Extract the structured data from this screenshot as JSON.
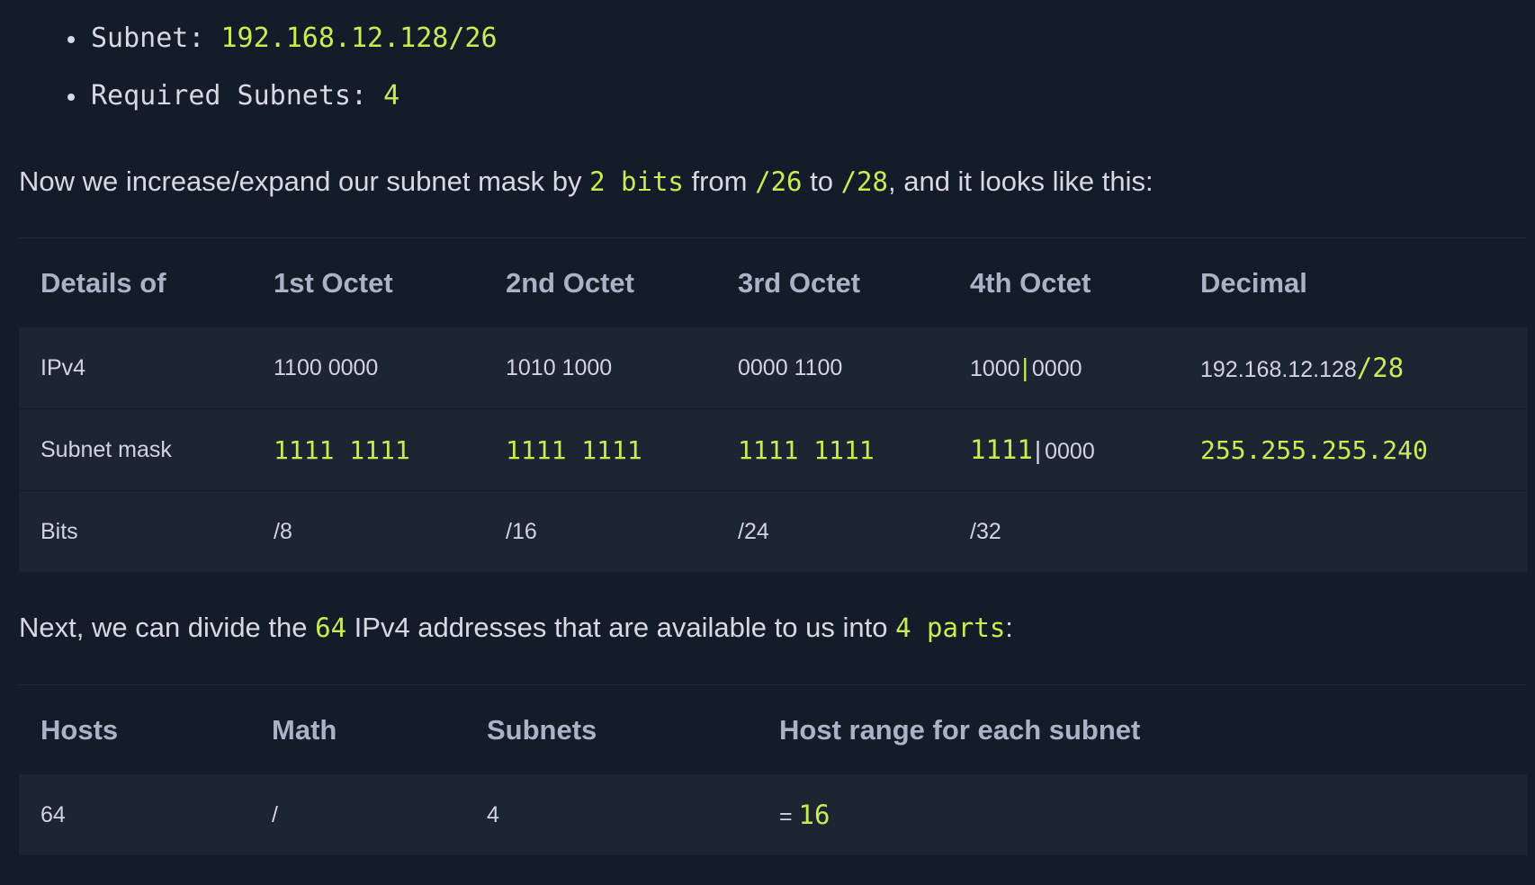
{
  "bullets": [
    {
      "label": "Subnet: ",
      "value": "192.168.12.128/26"
    },
    {
      "label": "Required Subnets: ",
      "value": "4"
    }
  ],
  "para1": {
    "t1": "Now we increase/expand our subnet mask by ",
    "c1": "2 bits",
    "t2": " from ",
    "c2": "/26",
    "t3": " to ",
    "c3": "/28",
    "t4": ", and it looks like this:"
  },
  "table1": {
    "headers": [
      "Details of",
      "1st Octet",
      "2nd Octet",
      "3rd Octet",
      "4th Octet",
      "Decimal"
    ],
    "rows": [
      {
        "label": "IPv4",
        "o1": "1100 0000",
        "o2": "1010 1000",
        "o3": "0000 1100",
        "o4a": "1000",
        "o4sep": "|",
        "o4b": "0000",
        "dec": "192.168.12.128",
        "dec_suffix": "/28"
      },
      {
        "label": "Subnet mask",
        "o1": "1111 1111",
        "o2": "1111 1111",
        "o3": "1111 1111",
        "o4a": "1111",
        "o4sep": "|",
        "o4b": "0000",
        "dec": "255.255.255.240"
      },
      {
        "label": "Bits",
        "o1": "/8",
        "o2": "/16",
        "o3": "/24",
        "o4": "/32",
        "dec": ""
      }
    ]
  },
  "para2": {
    "t1": "Next, we can divide the ",
    "c1": "64",
    "t2": " IPv4 addresses that are available to us into ",
    "c2": "4 parts",
    "t3": ":"
  },
  "table2": {
    "headers": [
      "Hosts",
      "Math",
      "Subnets",
      "Host range for each subnet"
    ],
    "row": {
      "hosts": "64",
      "math": "/",
      "subnets": "4",
      "eq": "= ",
      "result": "16"
    }
  },
  "colors": {
    "background": "#151c29",
    "row_background": "#1d2432",
    "accent": "#c6ee52",
    "text": "#d4d9e3",
    "header_text": "#aab3c6"
  }
}
